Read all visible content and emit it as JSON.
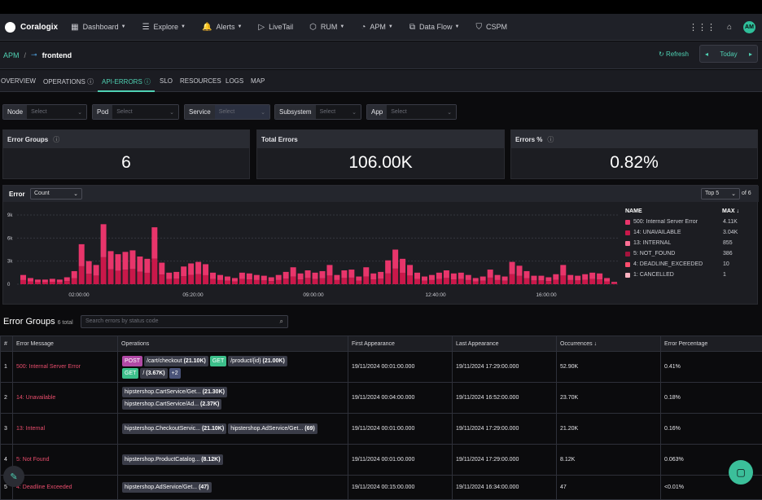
{
  "brand": {
    "name": "Coralogix"
  },
  "nav": [
    {
      "label": "Dashboard",
      "icon": "dashboard-icon",
      "glyph": "▦",
      "caret": true
    },
    {
      "label": "Explore",
      "icon": "explore-icon",
      "glyph": "☰",
      "caret": true
    },
    {
      "label": "Alerts",
      "icon": "bell-icon",
      "glyph": "🔔",
      "caret": true
    },
    {
      "label": "LiveTail",
      "icon": "play-icon",
      "glyph": "▷",
      "caret": false
    },
    {
      "label": "RUM",
      "icon": "cube-icon",
      "glyph": "⬡",
      "caret": true
    },
    {
      "label": "APM",
      "icon": "gauge-icon",
      "glyph": "◔",
      "caret": true
    },
    {
      "label": "Data Flow",
      "icon": "flow-icon",
      "glyph": "⧉",
      "caret": true
    },
    {
      "label": "CSPM",
      "icon": "shield-icon",
      "glyph": "⛉",
      "caret": false
    }
  ],
  "user": {
    "initials": "AM"
  },
  "breadcrumb": {
    "root": "APM",
    "separator": "/",
    "service": "frontend"
  },
  "refresh_label": "Refresh",
  "today_label": "Today",
  "tabs": [
    "OVERVIEW",
    "OPERATIONS",
    "API-ERRORS",
    "SLO",
    "RESOURCES",
    "LOGS",
    "MAP"
  ],
  "filters": [
    {
      "label": "Node",
      "placeholder": "Select"
    },
    {
      "label": "Pod",
      "placeholder": "Select"
    },
    {
      "label": "Service",
      "placeholder": "Select"
    },
    {
      "label": "Subsystem",
      "placeholder": "Select"
    },
    {
      "label": "App",
      "placeholder": "Select"
    }
  ],
  "cards": [
    {
      "title": "Error Groups",
      "value": "6",
      "info": true
    },
    {
      "title": "Total Errors",
      "value": "106.00K",
      "info": false
    },
    {
      "title": "Errors %",
      "value": "0.82%",
      "info": true
    }
  ],
  "chart_panel": {
    "title": "Error",
    "metric": "Count",
    "top": "Top 5",
    "of": "of 6"
  },
  "chart_data": {
    "type": "bar",
    "stacked": true,
    "x_tick_labels": [
      "02:00:00",
      "05:20:00",
      "09:00:00",
      "12:40:00",
      "16:00:00"
    ],
    "y_tick_labels": [
      "9k",
      "6k",
      "3k",
      "0"
    ],
    "ylim": [
      0,
      9000
    ],
    "legend_headers": {
      "name": "NAME",
      "max": "MAX"
    },
    "series": [
      {
        "name": "500: Internal Server Error",
        "max": "4.11K",
        "color": "#e8356b"
      },
      {
        "name": "14: UNAVAILABLE",
        "max": "3.04K",
        "color": "#c9184a"
      },
      {
        "name": "13: INTERNAL",
        "max": "855",
        "color": "#ff7096"
      },
      {
        "name": "5: NOT_FOUND",
        "max": "386",
        "color": "#a4133c"
      },
      {
        "name": "4: DEADLINE_EXCEEDED",
        "max": "10",
        "color": "#ff4d6d"
      },
      {
        "name": "1: CANCELLED",
        "max": "1",
        "color": "#ffb3c1"
      }
    ],
    "totals": [
      1200,
      800,
      600,
      600,
      700,
      600,
      900,
      1700,
      5200,
      3000,
      2500,
      7800,
      4300,
      3900,
      4200,
      4400,
      3600,
      3300,
      7400,
      2800,
      1500,
      1600,
      2300,
      2700,
      2900,
      2600,
      1500,
      1200,
      1000,
      800,
      1500,
      1400,
      1200,
      1100,
      900,
      1200,
      1600,
      2200,
      1400,
      1800,
      1500,
      1700,
      2500,
      1200,
      1800,
      1900,
      1000,
      2200,
      1400,
      1600,
      3100,
      4500,
      3300,
      2500,
      1500,
      1000,
      1200,
      1500,
      1800,
      1400,
      1500,
      1200,
      800,
      1000,
      1900,
      1200,
      1000,
      2900,
      2400,
      1700,
      1100,
      1100,
      900,
      1300,
      2500,
      1200,
      1100,
      1300,
      1500,
      1400,
      800,
      300
    ]
  },
  "error_groups": {
    "title": "Error Groups",
    "total_label": "6 total",
    "search_placeholder": "Search errors by status code",
    "columns": [
      "#",
      "Error Message",
      "Operations",
      "First Appearance",
      "Last Appearance",
      "Occurrences",
      "Error Percentage"
    ],
    "rows": [
      {
        "num": "1",
        "message": "500: Internal Server Error",
        "ops": [
          {
            "type": "post",
            "method": "POST",
            "path": "/cart/checkout",
            "count": "(21.10K)"
          },
          {
            "type": "get",
            "method": "GET",
            "path": "/product/{id}",
            "count": "(21.00K)"
          },
          {
            "type": "get",
            "method": "GET",
            "path": "/",
            "count": "(3.67K)"
          },
          {
            "type": "more",
            "path": "+2",
            "count": ""
          }
        ],
        "first": "19/11/2024 00:01:00.000",
        "last": "19/11/2024 17:29:00.000",
        "occ": "52.90K",
        "pct": "0.41%"
      },
      {
        "num": "2",
        "message": "14: Unavailable",
        "ops": [
          {
            "type": "op",
            "path": "hipstershop.CartService/Get...",
            "count": "(21.30K)"
          },
          {
            "type": "op",
            "path": "hipstershop.CartService/Ad...",
            "count": "(2.37K)"
          }
        ],
        "first": "19/11/2024 00:04:00.000",
        "last": "19/11/2024 16:52:00.000",
        "occ": "23.70K",
        "pct": "0.18%"
      },
      {
        "num": "3",
        "message": "13: Internal",
        "ops": [
          {
            "type": "op",
            "path": "hipstershop.CheckoutServic...",
            "count": "(21.10K)"
          },
          {
            "type": "op",
            "path": "hipstershop.AdService/Get...",
            "count": "(69)"
          }
        ],
        "first": "19/11/2024 00:01:00.000",
        "last": "19/11/2024 17:29:00.000",
        "occ": "21.20K",
        "pct": "0.16%"
      },
      {
        "num": "4",
        "message": "5: Not Found",
        "ops": [
          {
            "type": "op",
            "path": "hipstershop.ProductCatalog...",
            "count": "(8.12K)"
          }
        ],
        "first": "19/11/2024 00:01:00.000",
        "last": "19/11/2024 17:29:00.000",
        "occ": "8.12K",
        "pct": "0.063%"
      },
      {
        "num": "5",
        "message": "4: Deadline Exceeded",
        "ops": [
          {
            "type": "op",
            "path": "hipstershop.AdService/Get...",
            "count": "(47)"
          }
        ],
        "first": "19/11/2024 00:15:00.000",
        "last": "19/11/2024 16:34:00.000",
        "occ": "47",
        "pct": "<0.01%"
      }
    ]
  }
}
